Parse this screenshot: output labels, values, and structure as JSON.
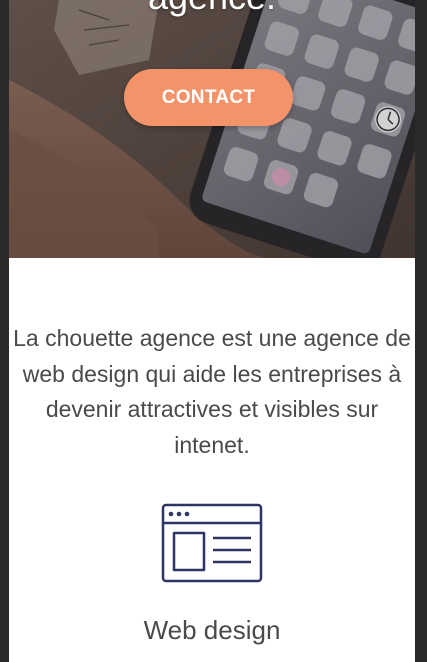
{
  "hero": {
    "title": "agence.",
    "cta_label": "CONTACT"
  },
  "intro": {
    "text": "La chouette agence est une agence de web design qui aide les entreprises à devenir attractives et visibles sur intenet."
  },
  "services": [
    {
      "title": "Web design",
      "icon": "web-design-icon"
    }
  ],
  "colors": {
    "accent": "#f4936a",
    "text": "#4a4a4a",
    "icon": "#2e3466",
    "background": "#ffffff",
    "frame": "#2a2a2a"
  }
}
